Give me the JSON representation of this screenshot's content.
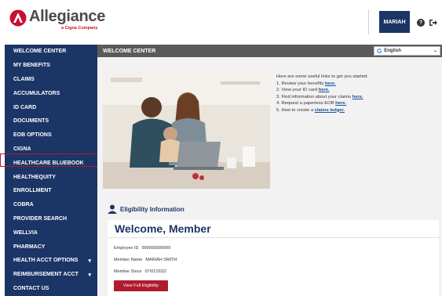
{
  "brand": {
    "name": "Allegiance",
    "tagline": "a Cigna Company",
    "accent": "#c8102e",
    "navy": "#1b3566"
  },
  "header": {
    "user_label": "MARIAH"
  },
  "sidebar": {
    "items": [
      {
        "label": "WELCOME CENTER"
      },
      {
        "label": "MY BENEFITS"
      },
      {
        "label": "CLAIMS"
      },
      {
        "label": "ACCUMULATORS"
      },
      {
        "label": "ID CARD"
      },
      {
        "label": "DOCUMENTS"
      },
      {
        "label": "EOB OPTIONS"
      },
      {
        "label": "CIGNA"
      },
      {
        "label": "HEALTHCARE BLUEBOOK"
      },
      {
        "label": "HEALTHEQUITY"
      },
      {
        "label": "ENROLLMENT"
      },
      {
        "label": "COBRA"
      },
      {
        "label": "PROVIDER SEARCH"
      },
      {
        "label": "WELLVIA"
      },
      {
        "label": "PHARMACY"
      },
      {
        "label": "HEALTH ACCT OPTIONS"
      },
      {
        "label": "REIMBURSEMENT ACCT"
      },
      {
        "label": "CONTACT US"
      }
    ]
  },
  "main": {
    "title": "WELCOME CENTER",
    "language": "English",
    "links_intro": "Here are some useful links to get you started:",
    "links": [
      {
        "text": "1. Review your benefits ",
        "link": "here."
      },
      {
        "text": "2. View your ID card ",
        "link": "here."
      },
      {
        "text": "3. Find information about your claims ",
        "link": "here."
      },
      {
        "text": "4. Request a paperless EOB ",
        "link": "here."
      },
      {
        "text": "5. How to create a ",
        "link": "claims ledger."
      }
    ],
    "eligibility_title": "Eligibility Information",
    "welcome": "Welcome, Member",
    "employee_id_label": "Employee ID",
    "employee_id": "999999999999",
    "member_name_label": "Member Name",
    "member_name": "MARIAH SMITH",
    "member_since_label": "Member Since",
    "member_since": "07/01/2022",
    "eligibility_button": "View Full Eligibility"
  }
}
